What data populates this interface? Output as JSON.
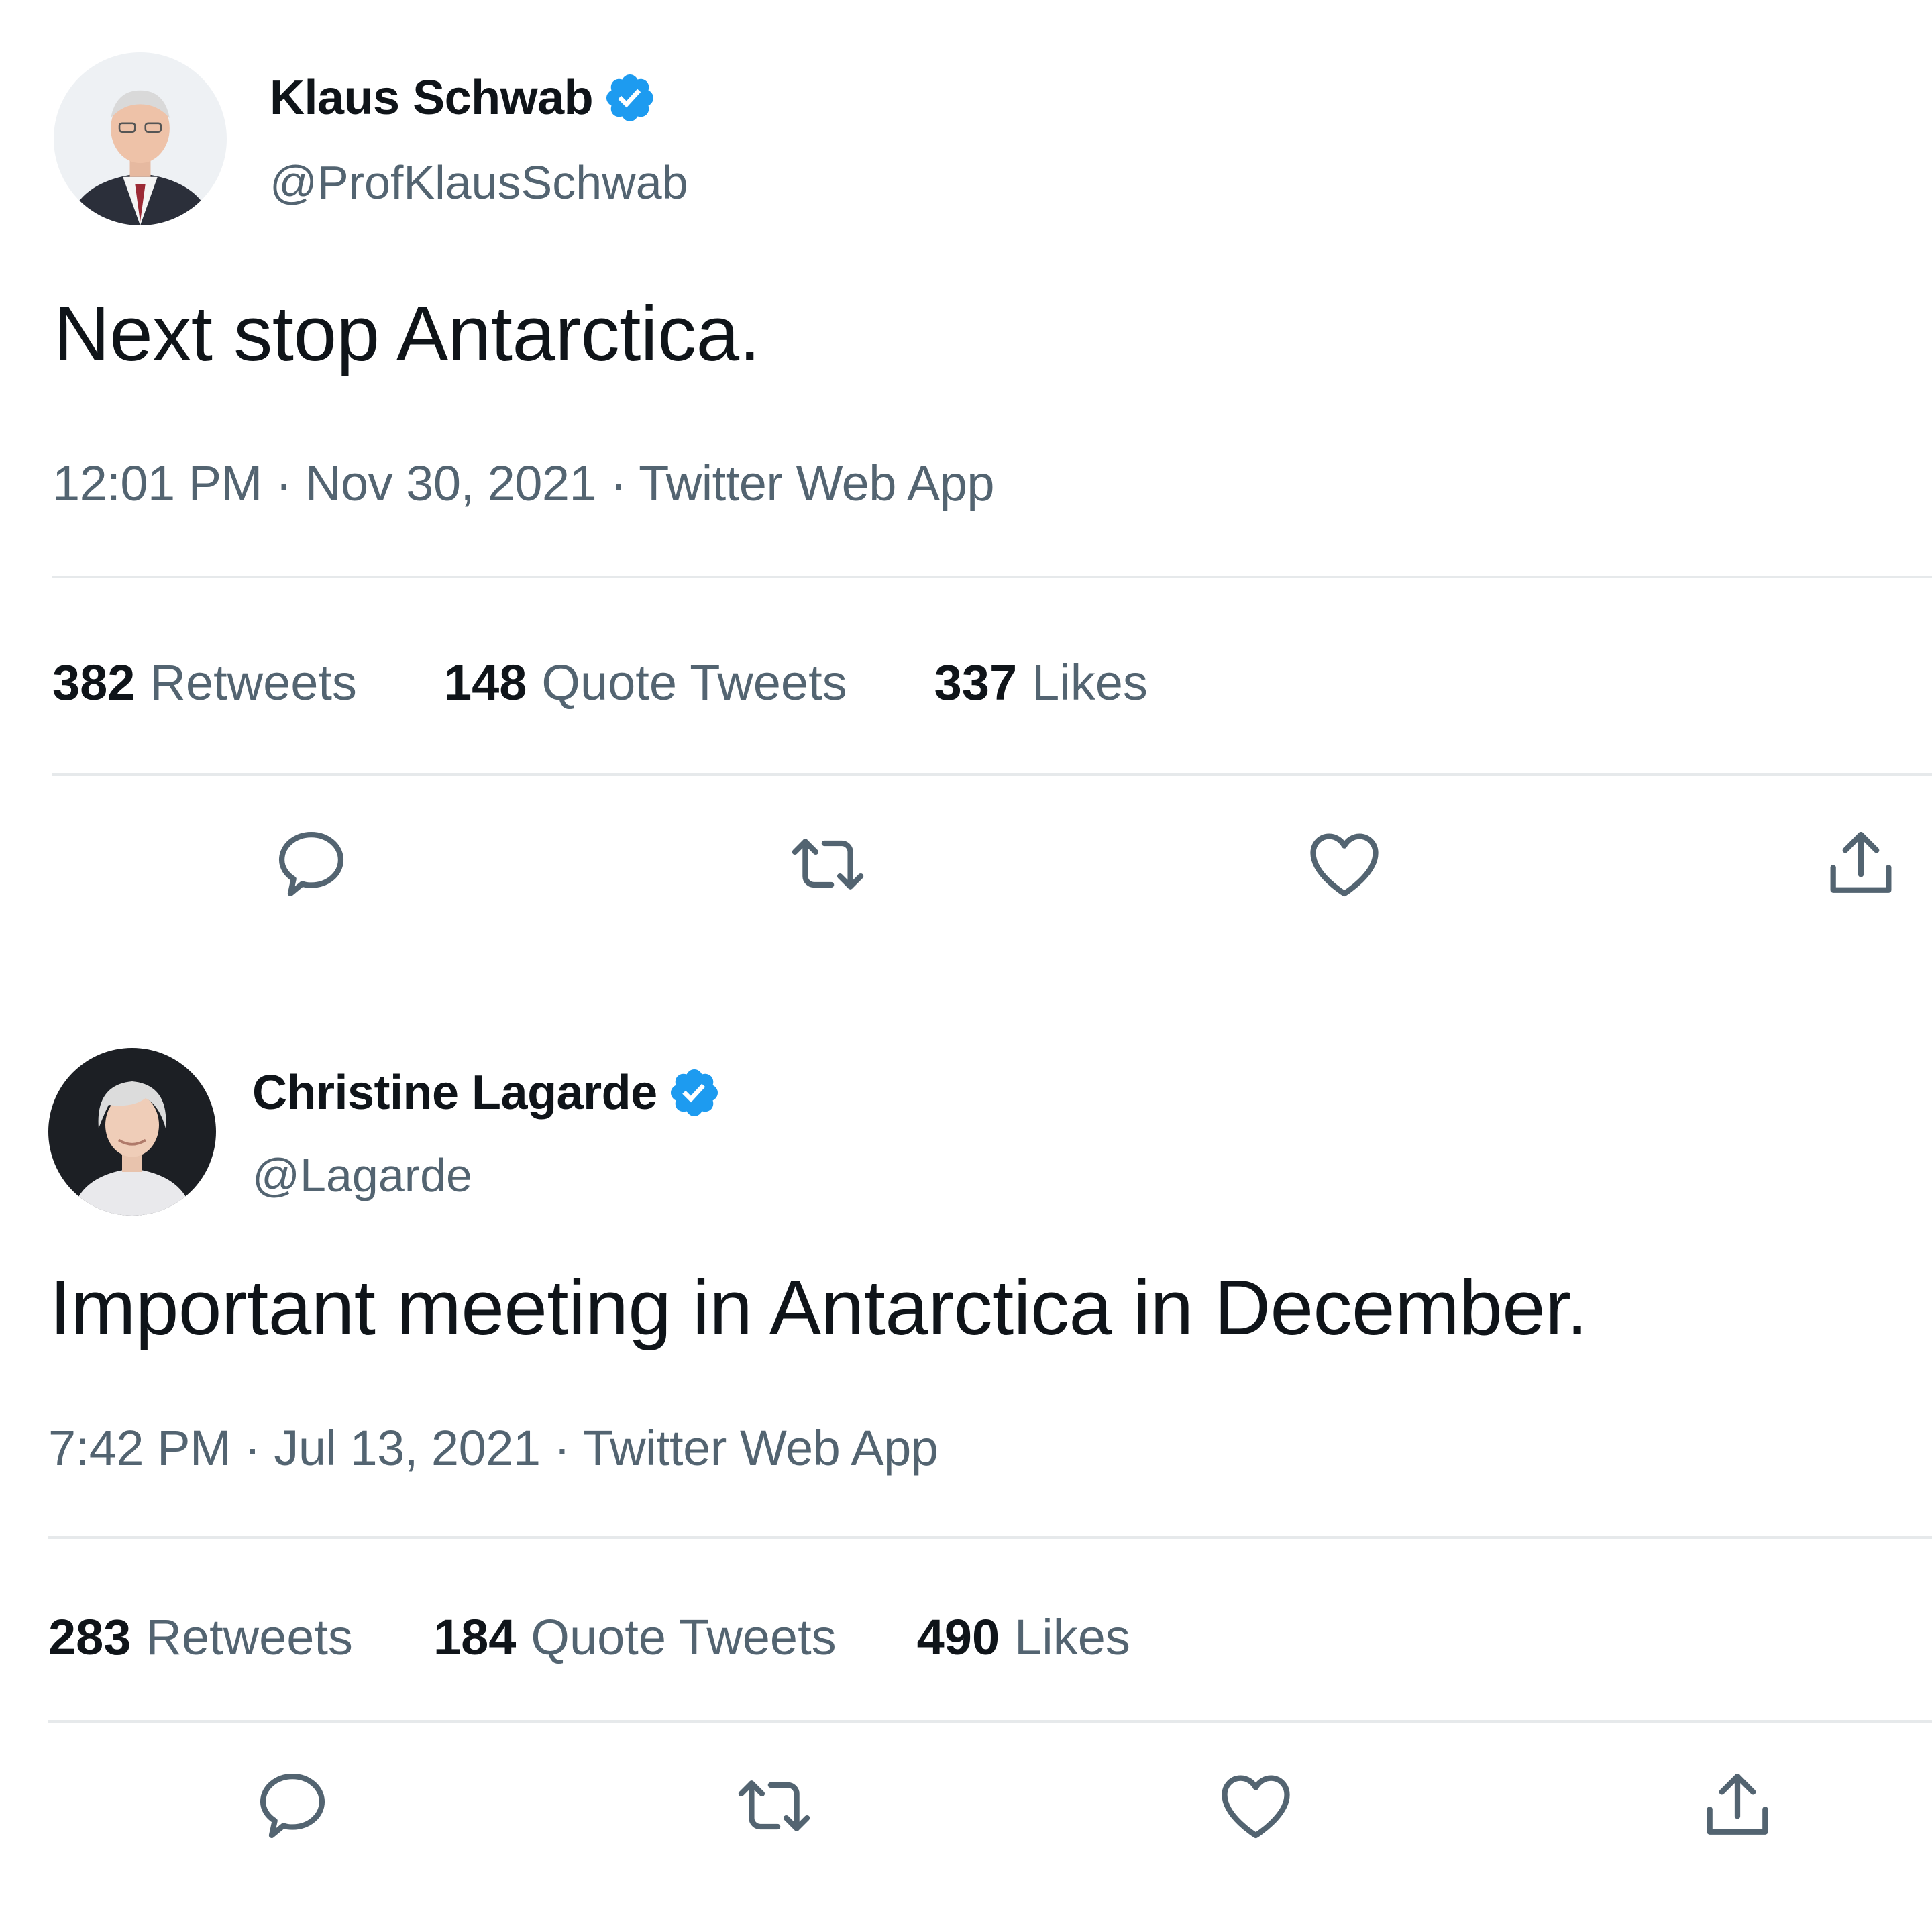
{
  "colors": {
    "primary_text": "#0f1419",
    "secondary_text": "#536471",
    "verified_blue": "#1d9bf0",
    "divider": "#e6e9eb"
  },
  "tweets": [
    {
      "display_name": "Klaus Schwab",
      "handle": "@ProfKlausSchwab",
      "verified": true,
      "text": "Next stop Antarctica.",
      "meta": "12:01 PM · Nov 30, 2021 · Twitter Web App",
      "stats": [
        {
          "count": "382",
          "label": "Retweets"
        },
        {
          "count": "148",
          "label": "Quote Tweets"
        },
        {
          "count": "337",
          "label": "Likes"
        }
      ],
      "actions": [
        "reply-icon",
        "retweet-icon",
        "like-icon",
        "share-icon"
      ]
    },
    {
      "display_name": "Christine Lagarde",
      "handle": "@Lagarde",
      "verified": true,
      "text": "Important meeting in Antarctica in December.",
      "meta": "7:42 PM · Jul 13, 2021 · Twitter Web App",
      "stats": [
        {
          "count": "283",
          "label": "Retweets"
        },
        {
          "count": "184",
          "label": "Quote Tweets"
        },
        {
          "count": "490",
          "label": "Likes"
        }
      ],
      "actions": [
        "reply-icon",
        "retweet-icon",
        "like-icon",
        "share-icon"
      ]
    }
  ]
}
